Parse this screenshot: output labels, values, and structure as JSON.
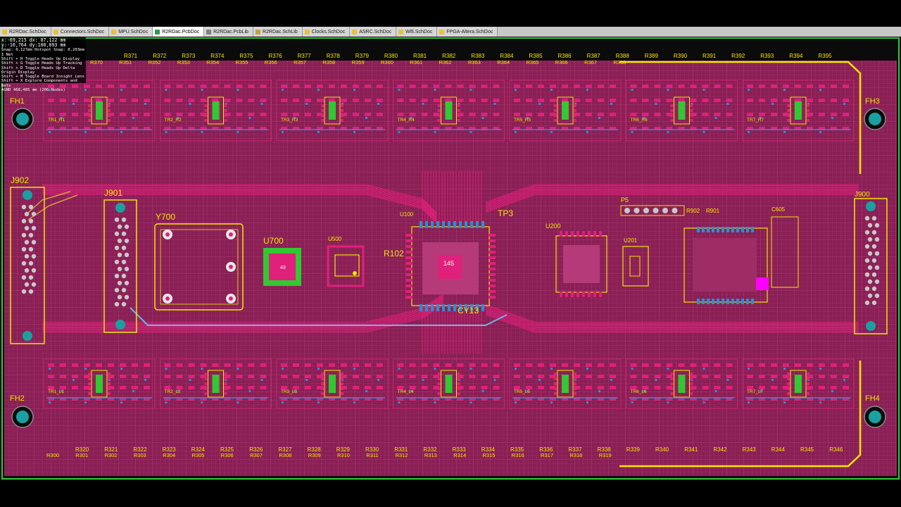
{
  "tabs": [
    {
      "label": "R2RDac.SchDoc",
      "icon": "schematic-icon",
      "active": false
    },
    {
      "label": "Connectors.SchDoc",
      "icon": "schematic-icon",
      "active": false
    },
    {
      "label": "MPU.SchDoc",
      "icon": "schematic-icon",
      "active": false
    },
    {
      "label": "R2RDac.PcbDoc",
      "icon": "pcb-icon",
      "active": true
    },
    {
      "label": "R2RDac.PcbLib",
      "icon": "pcblib-icon",
      "active": false
    },
    {
      "label": "R2RDac.SchLib",
      "icon": "schlib-icon",
      "active": false
    },
    {
      "label": "Clocks.SchDoc",
      "icon": "schematic-icon",
      "active": false
    },
    {
      "label": "ASRC.SchDoc",
      "icon": "schematic-icon",
      "active": false
    },
    {
      "label": "Wifi.SchDoc",
      "icon": "schematic-icon",
      "active": false
    },
    {
      "label": "FPGA-Altera.SchDoc",
      "icon": "schematic-icon",
      "active": false
    }
  ],
  "hud": {
    "line1": "x:-69,215  dx: 87,122  mm",
    "line2": "y:-16,764  dy:100,093 mm",
    "line3": "Snap: 0,127mm Hotspot Snap: 0,203mm",
    "line4": "1 Net",
    "line5": "Shift + H  Toggle Heads Up Display",
    "line6": "Shift + G  Toggle Heads Up Tracking",
    "line7": "Shift + D  Toggle Heads Up Delta Origin Display",
    "line8": "Shift + M  Toggle Board Insight Lens",
    "line9": "Shift + X  Explore Components and Nets",
    "line10": "AGND 468,485 mm (206 Nodes)"
  },
  "colors": {
    "board": "#8a1f55",
    "copper_top": "#e0207a",
    "copper_bottom": "#2a8fd6",
    "silk": "#f2e700",
    "mech": "#32c832",
    "hole": "#1aa0a0"
  },
  "board": {
    "mount_holes": [
      {
        "label": "FH1"
      },
      {
        "label": "FH3"
      },
      {
        "label": "FH2"
      },
      {
        "label": "FH4"
      }
    ],
    "connectors": {
      "j902": "J902",
      "j901": "J901",
      "j900": "J900",
      "p5": "P5"
    },
    "chips": {
      "y700": "Y700",
      "u700": "U700",
      "u500": "U500",
      "u100": "U100",
      "u200": "U200",
      "u201": "U201",
      "tp3": "TP3",
      "r102": "R102",
      "cy13": "CY13",
      "r902": "R902",
      "r901": "R901",
      "c605": "C605",
      "chip_mark_u700": "43",
      "chip_mark_u100": "145"
    },
    "top_resistors": [
      "R371",
      "R372",
      "R373",
      "R374",
      "R375",
      "R376",
      "R377",
      "R378",
      "R379",
      "R380",
      "R381",
      "R382",
      "R383",
      "R384",
      "R385",
      "R386",
      "R387",
      "R388",
      "R389",
      "R390",
      "R391",
      "R392",
      "R393",
      "R394",
      "R395"
    ],
    "top_resistors_row2": [
      "R370",
      "R351",
      "R352",
      "R353",
      "R354",
      "R355",
      "R356",
      "R357",
      "R358",
      "R359",
      "R360",
      "R361",
      "R362",
      "R363",
      "R364",
      "R365",
      "R366",
      "R367",
      "R368"
    ],
    "bottom_resistors": [
      "R320",
      "R321",
      "R322",
      "R323",
      "R324",
      "R325",
      "R326",
      "R327",
      "R328",
      "R329",
      "R330",
      "R331",
      "R332",
      "R333",
      "R334",
      "R335",
      "R336",
      "R337",
      "R338",
      "R339",
      "R340",
      "R341",
      "R342",
      "R343",
      "R344",
      "R345",
      "R346"
    ],
    "bottom_resistors_row2": [
      "R300",
      "R301",
      "R302",
      "R303",
      "R304",
      "R305",
      "R306",
      "R307",
      "R308",
      "R309",
      "R310",
      "R311",
      "R312",
      "R313",
      "R314",
      "R315",
      "R316",
      "R317",
      "R318",
      "R319"
    ],
    "top_channels": [
      "R1",
      "R2",
      "R3",
      "R4",
      "R5",
      "R6",
      "R7"
    ],
    "bottom_channels": [
      "L1",
      "L2",
      "L3",
      "L4",
      "L5",
      "L6",
      "L7"
    ]
  }
}
